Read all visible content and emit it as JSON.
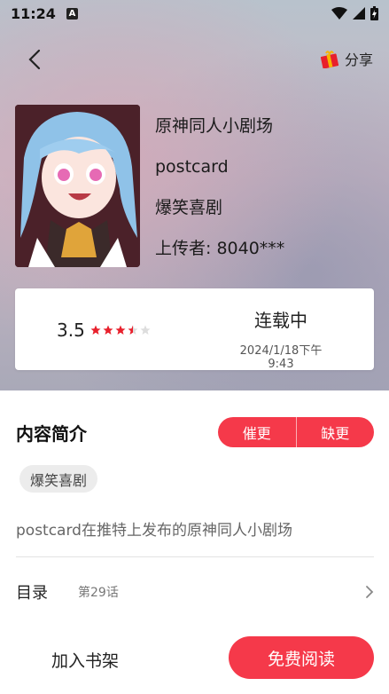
{
  "status_bar": {
    "time": "11:24",
    "badge": "A"
  },
  "header": {
    "share_label": "分享"
  },
  "book": {
    "title": "原神同人小剧场",
    "author": "postcard",
    "genre": "爆笑喜剧",
    "uploader": "上传者: 8040***"
  },
  "status_card": {
    "rating": "3.5",
    "stars_total": 5,
    "stars_value": 3.5,
    "serial_status": "连载中",
    "updated_at": "2024/1/18下午9:43"
  },
  "intro": {
    "title": "内容简介",
    "urge_label": "催更",
    "missing_label": "缺更",
    "tag": "爆笑喜剧",
    "description": "postcard在推特上发布的原神同人小剧场"
  },
  "toc": {
    "label": "目录",
    "latest_chapter": "第29话"
  },
  "bottom": {
    "add_shelf_label": "加入书架",
    "read_label": "免费阅读"
  },
  "colors": {
    "accent": "#f5394a",
    "star": "#e8202c"
  }
}
